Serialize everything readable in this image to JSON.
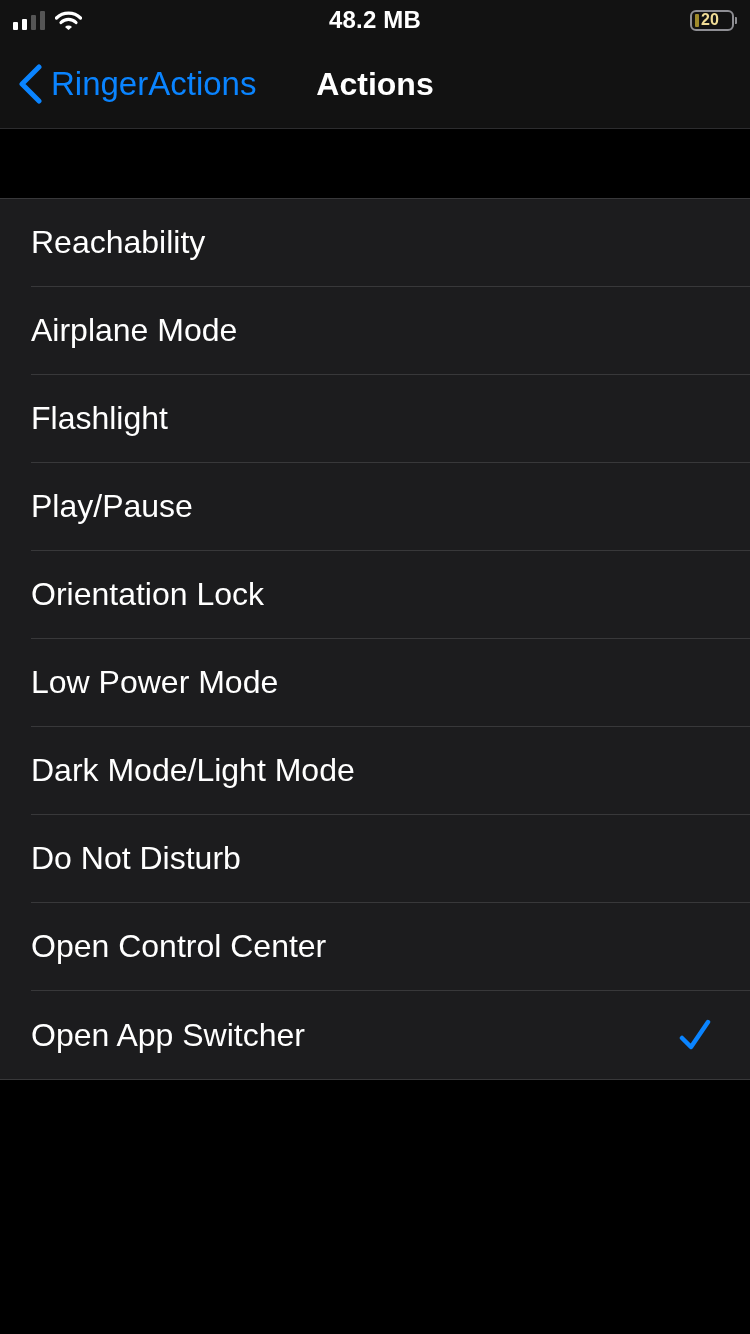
{
  "status_bar": {
    "memory": "48.2 MB",
    "battery": "20"
  },
  "nav_bar": {
    "back": "RingerActions",
    "title": "Actions"
  },
  "actions": [
    {
      "label": "Reachability",
      "selected": false
    },
    {
      "label": "Airplane Mode",
      "selected": false
    },
    {
      "label": "Flashlight",
      "selected": false
    },
    {
      "label": "Play/Pause",
      "selected": false
    },
    {
      "label": "Orientation Lock",
      "selected": false
    },
    {
      "label": "Low Power Mode",
      "selected": false
    },
    {
      "label": "Dark Mode/Light Mode",
      "selected": false
    },
    {
      "label": "Do Not Disturb",
      "selected": false
    },
    {
      "label": "Open Control Center",
      "selected": false
    },
    {
      "label": "Open App Switcher",
      "selected": true
    }
  ]
}
